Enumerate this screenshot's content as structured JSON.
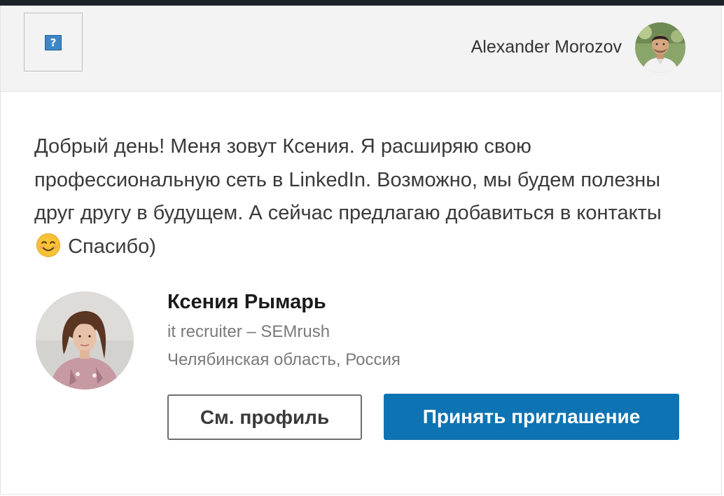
{
  "header": {
    "logo_icon": "broken-image-icon",
    "logo_glyph": "?",
    "sender_name": "Alexander Morozov",
    "sender_avatar_icon": "user-avatar"
  },
  "message": {
    "text_before_emoji": "Добрый день! Меня зовут Ксения. Я расширяю свою профессиональную сеть в LinkedIn. Возможно, мы будем полезны друг другу в будущем. А сейчас предлагаю добавиться в контакты",
    "emoji_icon": "smiling-face-emoji",
    "text_after_emoji": "Спасибо)"
  },
  "profile": {
    "avatar_icon": "profile-photo",
    "name": "Ксения Рымарь",
    "headline": "it recruiter – SEMrush",
    "location": "Челябинская область, Россия"
  },
  "actions": {
    "view_profile_label": "См. профиль",
    "accept_label": "Принять приглашение"
  },
  "colors": {
    "accent": "#0e73b3",
    "header_bg": "#f3f3f3",
    "top_bar": "#1d2226"
  }
}
